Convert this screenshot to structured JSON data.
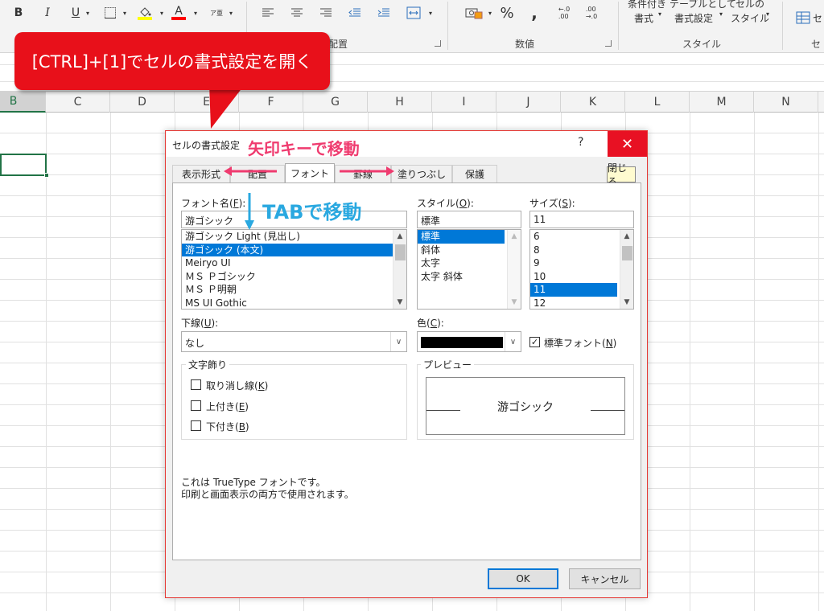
{
  "ribbon": {
    "font_buttons": [
      "B",
      "I",
      "U"
    ],
    "phonetic": "ア亜",
    "align_group": "配置",
    "number_group": "数値",
    "style_group": "スタイル",
    "percent": "%",
    "comma": ",",
    "cond_format_top": "条件付き",
    "cond_format_bottom": "書式",
    "table_top": "テーブルとして",
    "table_bottom": "書式設定",
    "cellstyle_top": "セルの",
    "cellstyle_bottom": "スタイル",
    "cells_label": "セ",
    "inc_decimal": "←.0\n.00",
    "dec_decimal": ".00\n→.0"
  },
  "colors": {
    "fill_color": "#ffff00",
    "font_color": "#ff0000",
    "callout": "#e8101a",
    "accent": "#217346",
    "selection": "#0078d7"
  },
  "callout": {
    "text": "[CTRL]+[1]でセルの書式設定を開く"
  },
  "grid": {
    "columns": [
      "B",
      "C",
      "D",
      "E",
      "F",
      "G",
      "H",
      "I",
      "J",
      "K",
      "L",
      "M",
      "N"
    ]
  },
  "dialog": {
    "title": "セルの書式設定",
    "help": "?",
    "close": "✕",
    "tabs": [
      "表示形式",
      "配置",
      "フォント",
      "罫線",
      "塗りつぶし",
      "保護"
    ],
    "close_small": "閉じる",
    "font_name_label": "フォント名(",
    "font_name_key": "F",
    "font_name_value": "游ゴシック",
    "font_list": [
      "游ゴシック Light (見出し)",
      "游ゴシック (本文)",
      "Meiryo UI",
      "ＭＳ Ｐゴシック",
      "ＭＳ Ｐ明朝",
      "MS UI Gothic"
    ],
    "style_label": "スタイル(",
    "style_key": "O",
    "style_value": "標準",
    "style_list": [
      "標準",
      "斜体",
      "太字",
      "太字 斜体"
    ],
    "size_label": "サイズ(",
    "size_key": "S",
    "size_value": "11",
    "size_list": [
      "6",
      "8",
      "9",
      "10",
      "11",
      "12"
    ],
    "underline_label": "下線(",
    "underline_key": "U",
    "underline_value": "なし",
    "color_label": "色(",
    "color_key": "C",
    "color_value": "#000000",
    "normal_font_label": "標準フォント(",
    "normal_font_key": "N",
    "effects_label": "文字飾り",
    "strikethrough": "取り消し線(",
    "strikethrough_key": "K",
    "superscript": "上付き(",
    "superscript_key": "E",
    "subscript": "下付き(",
    "subscript_key": "B",
    "preview_label": "プレビュー",
    "preview_text": "游ゴシック",
    "info_line1": "これは TrueType フォントです。",
    "info_line2": "印刷と画面表示の両方で使用されます。",
    "ok": "OK",
    "cancel": "キャンセル"
  },
  "annotations": {
    "arrow_keys": "矢印キーで移動",
    "tab_move": "TABで移動"
  }
}
